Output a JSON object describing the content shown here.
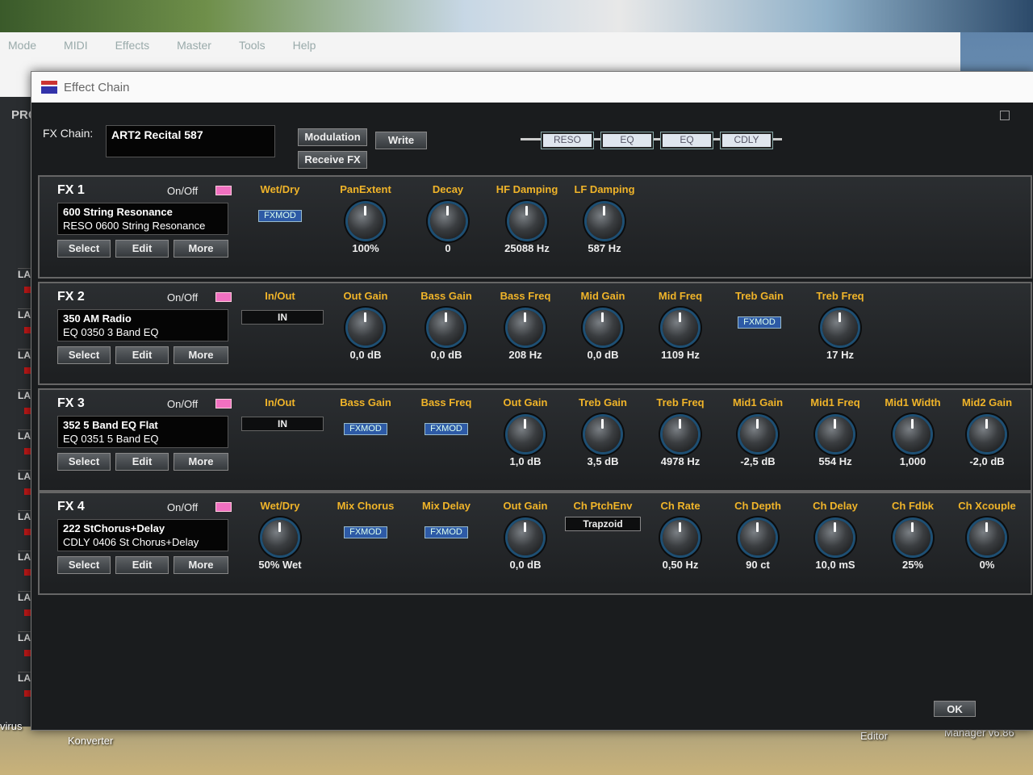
{
  "desktop": {
    "bg_menu": [
      "Mode",
      "MIDI",
      "Effects",
      "Master",
      "Tools",
      "Help"
    ],
    "bg_panel_title": "PRO",
    "layer_labels": [
      "LA",
      "LA",
      "LA",
      "LA",
      "LA",
      "LA",
      "LA",
      "LA",
      "LA",
      "LA",
      "LA"
    ],
    "icons": [
      "virus",
      "Konverter",
      "Editor",
      "Manager v6.86"
    ]
  },
  "window": {
    "title": "Effect Chain",
    "fx_chain_label": "FX Chain:",
    "fx_chain_name": "ART2 Recital 587",
    "buttons": {
      "modulation": "Modulation",
      "write": "Write",
      "receive": "Receive FX",
      "ok": "OK"
    },
    "chain_nodes": [
      "RESO",
      "EQ",
      "EQ",
      "CDLY"
    ]
  },
  "common": {
    "onoff": "On/Off",
    "select": "Select",
    "edit": "Edit",
    "more": "More",
    "fxmod": "FXMOD"
  },
  "fx": [
    {
      "title": "FX 1",
      "preset_line1": "600  String Resonance",
      "preset_line2": "RESO 0600 String Resonance",
      "params": [
        {
          "label": "Wet/Dry",
          "kind": "fxmod"
        },
        {
          "label": "PanExtent",
          "kind": "knob",
          "value": "100%"
        },
        {
          "label": "Decay",
          "kind": "knob",
          "value": "0"
        },
        {
          "label": "HF Damping",
          "kind": "knob",
          "value": "25088 Hz"
        },
        {
          "label": "LF Damping",
          "kind": "knob",
          "value": "587 Hz"
        }
      ]
    },
    {
      "title": "FX 2",
      "preset_line1": "350  AM Radio",
      "preset_line2": "EQ   0350 3 Band EQ",
      "params": [
        {
          "label": "In/Out",
          "kind": "in",
          "value": "IN"
        },
        {
          "label": "Out Gain",
          "kind": "knob",
          "value": "0,0 dB"
        },
        {
          "label": "Bass Gain",
          "kind": "knob",
          "value": "0,0 dB"
        },
        {
          "label": "Bass Freq",
          "kind": "knob",
          "value": "208 Hz"
        },
        {
          "label": "Mid Gain",
          "kind": "knob",
          "value": "0,0 dB"
        },
        {
          "label": "Mid Freq",
          "kind": "knob",
          "value": "1109 Hz"
        },
        {
          "label": "Treb Gain",
          "kind": "fxmod"
        },
        {
          "label": "Treb Freq",
          "kind": "knob",
          "value": "17 Hz"
        }
      ]
    },
    {
      "title": "FX 3",
      "preset_line1": "352  5 Band EQ Flat",
      "preset_line2": "EQ   0351 5 Band EQ",
      "params": [
        {
          "label": "In/Out",
          "kind": "in",
          "value": "IN"
        },
        {
          "label": "Bass Gain",
          "kind": "fxmod"
        },
        {
          "label": "Bass Freq",
          "kind": "fxmod"
        },
        {
          "label": "Out Gain",
          "kind": "knob",
          "value": "1,0 dB"
        },
        {
          "label": "Treb Gain",
          "kind": "knob",
          "value": "3,5 dB"
        },
        {
          "label": "Treb Freq",
          "kind": "knob",
          "value": "4978 Hz"
        },
        {
          "label": "Mid1 Gain",
          "kind": "knob",
          "value": "-2,5 dB"
        },
        {
          "label": "Mid1 Freq",
          "kind": "knob",
          "value": "554 Hz"
        },
        {
          "label": "Mid1 Width",
          "kind": "knob",
          "value": "1,000"
        },
        {
          "label": "Mid2 Gain",
          "kind": "knob",
          "value": "-2,0 dB"
        }
      ]
    },
    {
      "title": "FX 4",
      "preset_line1": "222  StChorus+Delay",
      "preset_line2": "CDLY 0406 St Chorus+Delay",
      "params": [
        {
          "label": "Wet/Dry",
          "kind": "knob",
          "value": "50% Wet"
        },
        {
          "label": "Mix Chorus",
          "kind": "fxmod"
        },
        {
          "label": "Mix Delay",
          "kind": "fxmod"
        },
        {
          "label": "Out Gain",
          "kind": "knob",
          "value": "0,0 dB"
        },
        {
          "label": "Ch PtchEnv",
          "kind": "select",
          "value": "Trapzoid"
        },
        {
          "label": "Ch Rate",
          "kind": "knob",
          "value": "0,50 Hz"
        },
        {
          "label": "Ch Depth",
          "kind": "knob",
          "value": "90 ct"
        },
        {
          "label": "Ch Delay",
          "kind": "knob",
          "value": "10,0 mS"
        },
        {
          "label": "Ch Fdbk",
          "kind": "knob",
          "value": "25%"
        },
        {
          "label": "Ch Xcouple",
          "kind": "knob",
          "value": "0%"
        }
      ]
    }
  ]
}
